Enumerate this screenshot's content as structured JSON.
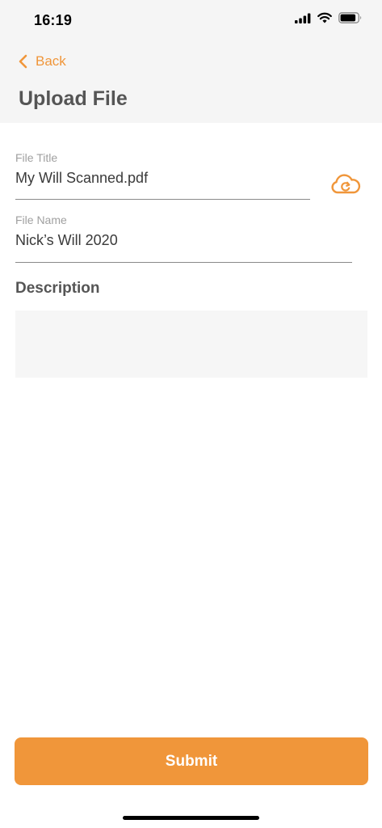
{
  "status_bar": {
    "time": "16:19"
  },
  "nav": {
    "back_label": "Back",
    "title": "Upload File"
  },
  "form": {
    "file_title": {
      "label": "File Title",
      "value": "My Will Scanned.pdf"
    },
    "file_name": {
      "label": "File Name",
      "value": "Nick’s Will 2020"
    },
    "description": {
      "heading": "Description",
      "value": ""
    }
  },
  "actions": {
    "submit_label": "Submit"
  },
  "icons": {
    "back": "chevron-left-icon",
    "upload": "cloud-sync-icon",
    "signal": "signal-icon",
    "wifi": "wifi-icon",
    "battery": "battery-icon"
  },
  "colors": {
    "accent": "#f0963a",
    "header_bg": "#f5f5f5",
    "text": "#555555"
  }
}
